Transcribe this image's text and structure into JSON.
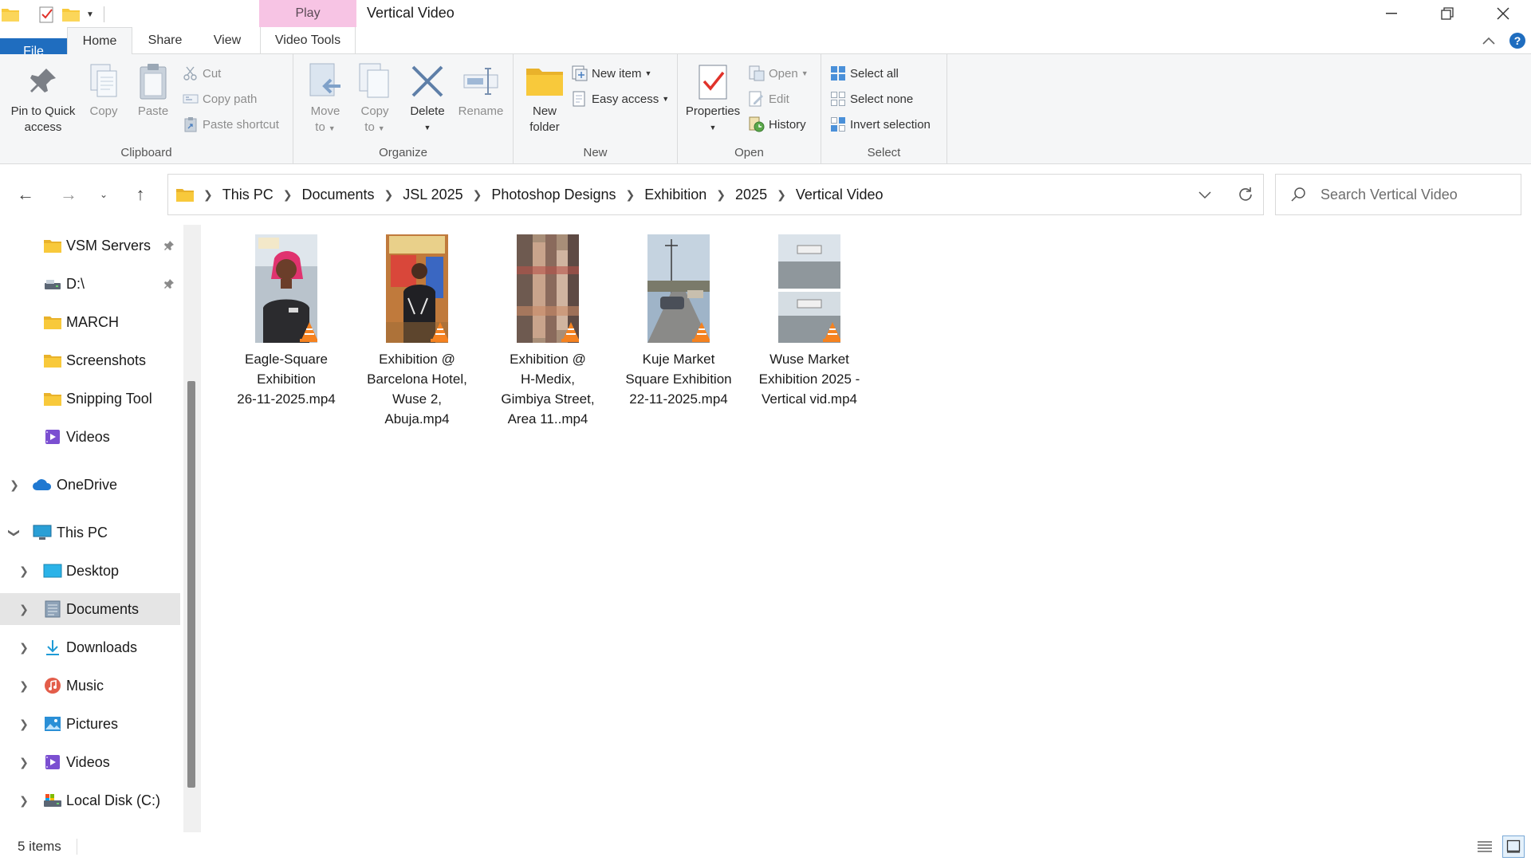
{
  "window": {
    "title": "Vertical Video",
    "contextual_tab_group": "Play",
    "controls": [
      "minimize",
      "restore",
      "close"
    ]
  },
  "ribbon_tabs": [
    "File",
    "Home",
    "Share",
    "View",
    "Video Tools"
  ],
  "ribbon": {
    "clipboard": {
      "label": "Clipboard",
      "pin_label_1": "Pin to Quick",
      "pin_label_2": "access",
      "copy": "Copy",
      "paste": "Paste",
      "cut": "Cut",
      "copy_path": "Copy path",
      "paste_shortcut": "Paste shortcut"
    },
    "organize": {
      "label": "Organize",
      "move_1": "Move",
      "move_2": "to",
      "copy_1": "Copy",
      "copy_2": "to",
      "delete": "Delete",
      "rename": "Rename"
    },
    "new": {
      "label": "New",
      "folder_1": "New",
      "folder_2": "folder",
      "new_item": "New item",
      "easy_access": "Easy access"
    },
    "open": {
      "label": "Open",
      "properties": "Properties",
      "open": "Open",
      "edit": "Edit",
      "history": "History"
    },
    "select": {
      "label": "Select",
      "select_all": "Select all",
      "select_none": "Select none",
      "invert": "Invert selection"
    }
  },
  "breadcrumb": [
    "This PC",
    "Documents",
    "JSL 2025",
    "Photoshop Designs",
    "Exhibition",
    "2025",
    "Vertical Video"
  ],
  "search": {
    "placeholder": "Search Vertical Video"
  },
  "nav_pane": [
    {
      "label": "VSM Servers",
      "icon": "folder-icon",
      "pinned": true
    },
    {
      "label": "D:\\",
      "icon": "drive-icon",
      "pinned": true
    },
    {
      "label": "MARCH",
      "icon": "folder-icon"
    },
    {
      "label": "Screenshots",
      "icon": "folder-icon"
    },
    {
      "label": "Snipping Tool",
      "icon": "folder-icon"
    },
    {
      "label": "Videos",
      "icon": "videos-icon"
    },
    {
      "label": "OneDrive",
      "icon": "cloud-icon"
    },
    {
      "label": "This PC",
      "icon": "computer-icon"
    },
    {
      "label": "Desktop",
      "icon": "desktop-icon"
    },
    {
      "label": "Documents",
      "icon": "documents-icon",
      "selected": true
    },
    {
      "label": "Downloads",
      "icon": "download-icon"
    },
    {
      "label": "Music",
      "icon": "music-icon"
    },
    {
      "label": "Pictures",
      "icon": "pictures-icon"
    },
    {
      "label": "Videos",
      "icon": "videos-icon"
    },
    {
      "label": "Local Disk (C:)",
      "icon": "disk-icon"
    }
  ],
  "files": [
    {
      "line1": "Eagle-Square",
      "line2": "Exhibition",
      "line3": "26-11-2025.mp4",
      "line4": ""
    },
    {
      "line1": "Exhibition @",
      "line2": "Barcelona Hotel,",
      "line3": "Wuse 2,",
      "line4": "Abuja.mp4"
    },
    {
      "line1": "Exhibition @",
      "line2": "H-Medix,",
      "line3": "Gimbiya Street,",
      "line4": "Area 11..mp4"
    },
    {
      "line1": "Kuje Market",
      "line2": "Square Exhibition",
      "line3": "22-11-2025.mp4",
      "line4": ""
    },
    {
      "line1": "Wuse Market",
      "line2": "Exhibition 2025 -",
      "line3": "Vertical vid.mp4",
      "line4": ""
    }
  ],
  "status": {
    "item_count": "5 items"
  },
  "colors": {
    "file_tab": "#1f6dbf",
    "play_tab": "#f7c4e4",
    "folder": "#f8c93b",
    "selected_nav": "#e5e5e5"
  }
}
